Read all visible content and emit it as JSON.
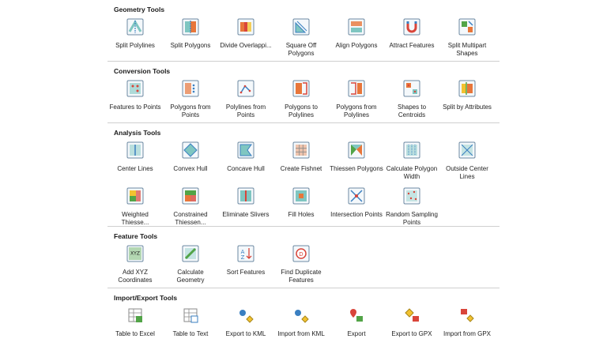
{
  "sections": [
    {
      "title": "Geometry Tools",
      "tools": [
        {
          "label": "Split Polylines",
          "icon": "split-polylines-icon"
        },
        {
          "label": "Split Polygons",
          "icon": "split-polygons-icon"
        },
        {
          "label": "Divide Overlappi...",
          "icon": "divide-overlapping-icon"
        },
        {
          "label": "Square Off Polygons",
          "icon": "square-off-icon"
        },
        {
          "label": "Align Polygons",
          "icon": "align-polygons-icon"
        },
        {
          "label": "Attract Features",
          "icon": "magnet-icon"
        },
        {
          "label": "Split Multipart Shapes",
          "icon": "split-multipart-icon"
        }
      ]
    },
    {
      "title": "Conversion Tools",
      "tools": [
        {
          "label": "Features to Points",
          "icon": "features-to-points-icon"
        },
        {
          "label": "Polygons from Points",
          "icon": "polygons-from-points-icon"
        },
        {
          "label": "Polylines from Points",
          "icon": "polylines-from-points-icon"
        },
        {
          "label": "Polygons to Polylines",
          "icon": "polygons-to-polylines-icon"
        },
        {
          "label": "Polygons from Polylines",
          "icon": "polygons-from-polylines-icon"
        },
        {
          "label": "Shapes to Centroids",
          "icon": "shapes-to-centroids-icon"
        },
        {
          "label": "Split by Attributes",
          "icon": "split-by-attributes-icon"
        }
      ]
    },
    {
      "title": "Analysis Tools",
      "tools": [
        {
          "label": "Center Lines",
          "icon": "center-lines-icon"
        },
        {
          "label": "Convex Hull",
          "icon": "convex-hull-icon"
        },
        {
          "label": "Concave Hull",
          "icon": "concave-hull-icon"
        },
        {
          "label": "Create Fishnet",
          "icon": "fishnet-icon"
        },
        {
          "label": "Thiessen Polygons",
          "icon": "thiessen-icon"
        },
        {
          "label": "Calculate Polygon Width",
          "icon": "polygon-width-icon"
        },
        {
          "label": "Outside Center Lines",
          "icon": "outside-center-lines-icon"
        },
        {
          "label": "Weighted Thiesse...",
          "icon": "weighted-thiessen-icon"
        },
        {
          "label": "Constrained Thiessen...",
          "icon": "constrained-thiessen-icon"
        },
        {
          "label": "Eliminate Slivers",
          "icon": "eliminate-slivers-icon"
        },
        {
          "label": "Fill Holes",
          "icon": "fill-holes-icon"
        },
        {
          "label": "Intersection Points",
          "icon": "intersection-points-icon"
        },
        {
          "label": "Random Sampling Points",
          "icon": "random-sampling-icon"
        }
      ]
    },
    {
      "title": "Feature Tools",
      "tools": [
        {
          "label": "Add XYZ Coordinates",
          "icon": "xyz-icon"
        },
        {
          "label": "Calculate Geometry",
          "icon": "calculate-geometry-icon"
        },
        {
          "label": "Sort Features",
          "icon": "sort-icon"
        },
        {
          "label": "Find Duplicate Features",
          "icon": "find-duplicate-icon"
        }
      ]
    },
    {
      "title": "Import/Export Tools",
      "tools": [
        {
          "label": "Table to Excel",
          "icon": "excel-icon"
        },
        {
          "label": "Table to Text",
          "icon": "table-to-text-icon"
        },
        {
          "label": "Export to KML",
          "icon": "export-kml-icon"
        },
        {
          "label": "Import from KML",
          "icon": "import-kml-icon"
        },
        {
          "label": "Export",
          "icon": "export-icon"
        },
        {
          "label": "Export to GPX",
          "icon": "export-gpx-icon"
        },
        {
          "label": "Import from GPX",
          "icon": "import-gpx-icon"
        }
      ]
    }
  ],
  "colors": {
    "blue": "#3a7fc1",
    "green": "#52a447",
    "orange": "#e8763a",
    "red": "#d9453a",
    "yellow": "#f2c230",
    "teal": "#7fc6c1",
    "gray": "#8a8a8a"
  }
}
